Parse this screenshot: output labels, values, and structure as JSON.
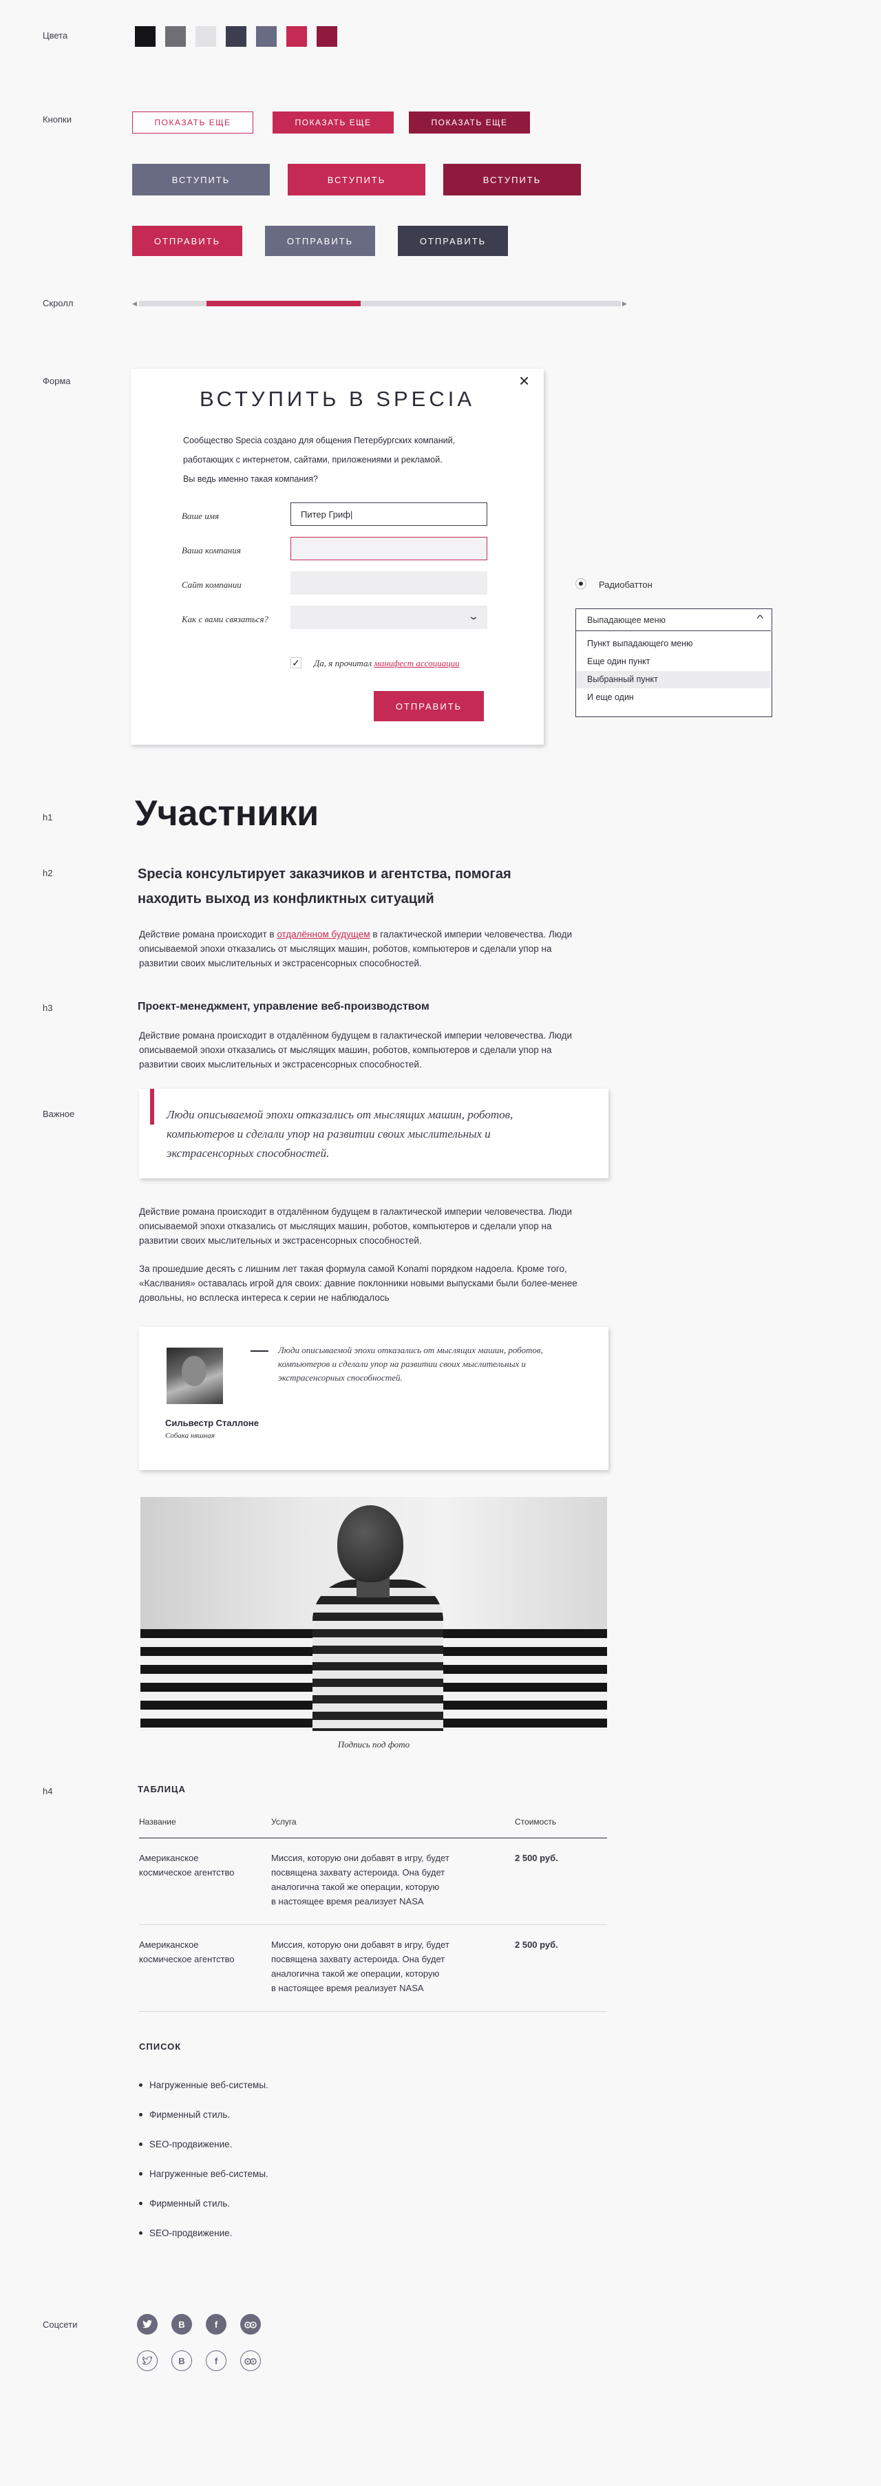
{
  "labels": {
    "colors": "Цвета",
    "buttons": "Кнопки",
    "scroll": "Скролл",
    "form": "Форма",
    "h1": "h1",
    "h2": "h2",
    "h3": "h3",
    "important": "Важное",
    "h4": "h4",
    "social": "Соцсети"
  },
  "palette": [
    "#141417",
    "#6e6e73",
    "#e3e3e6",
    "#3c3d4e",
    "#696b82",
    "#c42a53",
    "#8f1a3d"
  ],
  "buttons": {
    "show_more": "ПОКАЗАТЬ ЕЩЕ",
    "join": "ВСТУПИТЬ",
    "send": "ОТПРАВИТЬ"
  },
  "scroll": {
    "position": 0.14,
    "thumb_fraction": 0.32
  },
  "form": {
    "title": "ВСТУПИТЬ В SPECIA",
    "intro_1": "Сообщество Specia создано для общения Петербургских компаний,",
    "intro_2": "работающих с интернетом, сайтами, приложениями и рекламой.",
    "intro_3": "Вы ведь именно такая компания?",
    "name_label": "Ваше имя",
    "name_value": "Питер Гриф",
    "company_label": "Ваша компания",
    "site_label": "Сайт компании",
    "contact_label": "Как с вами связаться?",
    "agree_text": "Да, я прочитал",
    "agree_link": "манифест ассоциации",
    "submit": "ОТПРАВИТЬ"
  },
  "radio": {
    "label": "Радиобаттон"
  },
  "dropdown": {
    "header": "Выпадающее меню",
    "items": [
      "Пункт выпадающего меню",
      "Еще один пункт",
      "Выбранный пункт",
      "И еще один"
    ]
  },
  "typography": {
    "h1": "Участники",
    "h2_line1": "Specia консультирует заказчиков и агентства, помогая",
    "h2_line2": "находить выход из конфликтных ситуаций",
    "p1_line1_a": "Действие романа происходит в ",
    "p1_link": "отдалённом будущем",
    "p1_line1_b": " в галактической империи человечества. Люди",
    "p_line2": "описываемой эпохи отказались от мыслящих машин, роботов, компьютеров и сделали упор на",
    "p_line3": "развитии своих мыслительных и экстрасенсорных способностей.",
    "h3": "Проект-менеджмент, управление веб-производством",
    "p_line1": "Действие романа происходит в отдалённом будущем в галактической империи человечества. Люди",
    "quote_1": "Люди описываемой эпохи отказались от мыслящих машин, роботов,",
    "quote_2": "компьютеров и сделали упор на развитии своих мыслительных и",
    "quote_3": "экстрасенсорных способностей.",
    "p4_line1": "За прошедшие десять с лишним лет такая формула самой Konami порядком надоела. Кроме того,",
    "p4_line2": "«Каслвания» оставалась игрой для своих: давние поклонники новыми выпусками были более-менее",
    "p4_line3": "довольны, но всплеска интереса к серии не наблюдалось"
  },
  "testimonial": {
    "name": "Сильвестр Сталлоне",
    "role": "Собака няшная",
    "quote_1": "Люди описываемой эпохи отказались от мыслящих машин, роботов,",
    "quote_2": "компьютеров и сделали упор на развитии своих мыслительных и",
    "quote_3": "экстрасенсорных способностей."
  },
  "photo": {
    "caption": "Подпись под фото"
  },
  "table": {
    "title": "ТАБЛИЦА",
    "headers": [
      "Название",
      "Услуга",
      "Стоимость"
    ],
    "rows": [
      {
        "name_1": "Американское",
        "name_2": "космическое агентство",
        "service_1": "Миссия, которую они добавят в игру, будет",
        "service_2": "посвящена захвату астероида. Она будет",
        "service_3": "аналогична такой же операции, которую",
        "service_4": "в настоящее время реализует NASA",
        "price": "2 500 руб."
      },
      {
        "name_1": "Американское",
        "name_2": "космическое агентство",
        "service_1": "Миссия, которую они добавят в игру, будет",
        "service_2": "посвящена захвату астероида. Она будет",
        "service_3": "аналогична такой же операции, которую",
        "service_4": "в настоящее время реализует NASA",
        "price": "2 500 руб."
      }
    ]
  },
  "list": {
    "title": "СПИСОК",
    "items": [
      "Нагруженные веб-системы.",
      "Фирменный стиль.",
      "SEO-продвижение.",
      "Нагруженные веб-системы.",
      "Фирменный стиль.",
      "SEO-продвижение."
    ]
  },
  "social": {
    "icons": [
      "twitter-icon",
      "vk-icon",
      "facebook-icon",
      "tripadvisor-icon"
    ],
    "glyphs": [
      "",
      "В",
      "f",
      ""
    ]
  }
}
